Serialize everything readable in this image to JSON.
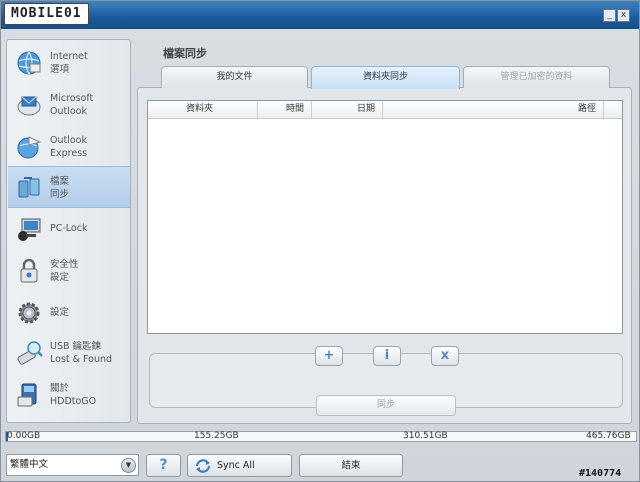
{
  "window": {
    "logo_text": "MOBILE01",
    "minimize_glyph": "_",
    "close_glyph": "x"
  },
  "sidebar": {
    "items": [
      {
        "label": "Internet\n選項",
        "icon": "globe-icon"
      },
      {
        "label": "Microsoft\nOutlook",
        "icon": "outlook-icon"
      },
      {
        "label": "Outlook\nExpress",
        "icon": "outlook-express-icon"
      },
      {
        "label": "檔案\n同步",
        "icon": "file-sync-icon",
        "active": true
      },
      {
        "label": "PC-Lock",
        "icon": "pc-lock-icon"
      },
      {
        "label": "安全性\n設定",
        "icon": "security-icon"
      },
      {
        "label": "設定",
        "icon": "settings-icon"
      },
      {
        "label": "USB 鑰匙鍊\nLost & Found",
        "icon": "usb-lost-found-icon"
      },
      {
        "label": "關於\nHDDtoGO",
        "icon": "about-icon"
      }
    ]
  },
  "main": {
    "section_title": "檔案同步",
    "tabs": [
      {
        "label": "我的文件",
        "state": "normal"
      },
      {
        "label": "資料夾同步",
        "state": "active"
      },
      {
        "label": "管理已加密的資料",
        "state": "disabled"
      }
    ],
    "list": {
      "columns": [
        "資料夾",
        "時間",
        "日期",
        "路徑"
      ]
    },
    "actions": {
      "add": "+",
      "info": "i",
      "remove": "x"
    },
    "sync_button": "同步"
  },
  "status": {
    "ticks": [
      "0.00GB",
      "155.25GB",
      "310.51GB",
      "465.76GB"
    ],
    "used_fraction": 0.003
  },
  "footer": {
    "language": "繁體中文",
    "help": "?",
    "sync_all": "Sync All",
    "exit": "結束"
  },
  "watermark": "#140774",
  "colors": {
    "accent": "#2f5d91",
    "title_bar": "#1c5a9a",
    "active_item": "#c9ddf2"
  }
}
